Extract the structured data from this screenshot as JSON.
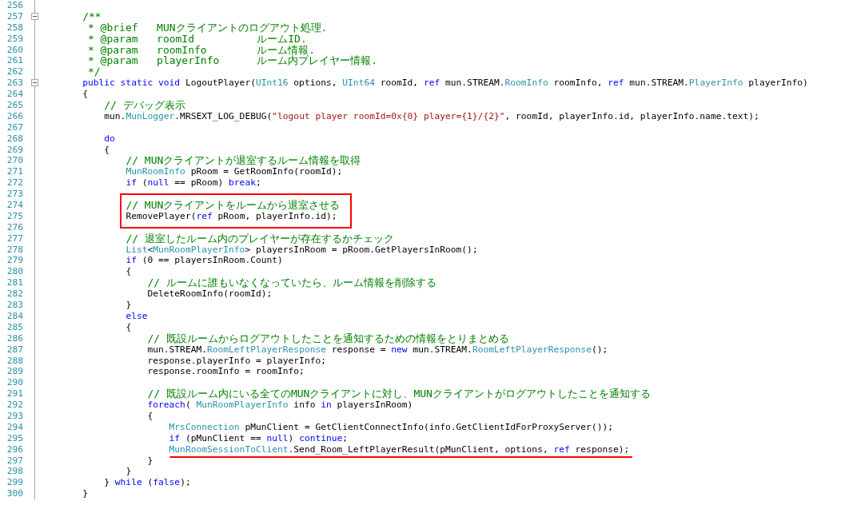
{
  "editor": {
    "lines": [
      {
        "number": "256"
      },
      {
        "number": "257",
        "expanded": true,
        "tokens": [
          {
            "kind": "comment",
            "text": "        /**"
          }
        ]
      },
      {
        "number": "258",
        "tokens": [
          {
            "kind": "comment",
            "text": "         * @brief   MUNクライアントのログアウト処理."
          }
        ]
      },
      {
        "number": "259",
        "tokens": [
          {
            "kind": "comment",
            "text": "         * @param   roomId          ルームID."
          }
        ]
      },
      {
        "number": "260",
        "tokens": [
          {
            "kind": "comment",
            "text": "         * @param   roomInfo        ルーム情報."
          }
        ]
      },
      {
        "number": "261",
        "tokens": [
          {
            "kind": "comment",
            "text": "         * @param   playerInfo      ルーム内プレイヤー情報."
          }
        ]
      },
      {
        "number": "262",
        "tokens": [
          {
            "kind": "comment",
            "text": "         */"
          }
        ]
      },
      {
        "number": "263",
        "expanded": true,
        "tokens": [
          {
            "kind": "keyword",
            "text": "        public static void"
          },
          {
            "kind": "plain",
            "text": " LogoutPlayer("
          },
          {
            "kind": "type",
            "text": "UInt16"
          },
          {
            "kind": "plain",
            "text": " options, "
          },
          {
            "kind": "type",
            "text": "UInt64"
          },
          {
            "kind": "plain",
            "text": " roomId, "
          },
          {
            "kind": "keyword",
            "text": "ref"
          },
          {
            "kind": "plain",
            "text": " mun.STREAM."
          },
          {
            "kind": "type",
            "text": "RoomInfo"
          },
          {
            "kind": "plain",
            "text": " roomInfo, "
          },
          {
            "kind": "keyword",
            "text": "ref"
          },
          {
            "kind": "plain",
            "text": " mun.STREAM."
          },
          {
            "kind": "type",
            "text": "PlayerInfo"
          },
          {
            "kind": "plain",
            "text": " playerInfo)"
          }
        ]
      },
      {
        "number": "264",
        "tokens": [
          {
            "kind": "plain",
            "text": "        {"
          }
        ]
      },
      {
        "number": "265",
        "tokens": [
          {
            "kind": "comment",
            "text": "            // デバッグ表示"
          }
        ]
      },
      {
        "number": "266",
        "tokens": [
          {
            "kind": "plain",
            "text": "            mun."
          },
          {
            "kind": "type",
            "text": "MunLogger"
          },
          {
            "kind": "plain",
            "text": ".MRSEXT_LOG_DEBUG("
          },
          {
            "kind": "string",
            "text": "\"logout player roomId=0x{0} player={1}/{2}\""
          },
          {
            "kind": "plain",
            "text": ", roomId, playerInfo.id, playerInfo.name.text);"
          }
        ]
      },
      {
        "number": "267"
      },
      {
        "number": "268",
        "tokens": [
          {
            "kind": "keyword",
            "text": "            do"
          }
        ]
      },
      {
        "number": "269",
        "tokens": [
          {
            "kind": "plain",
            "text": "            {"
          }
        ]
      },
      {
        "number": "270",
        "tokens": [
          {
            "kind": "comment",
            "text": "                // MUNクライアントが退室するルーム情報を取得"
          }
        ]
      },
      {
        "number": "271",
        "tokens": [
          {
            "kind": "type",
            "text": "                MunRoomInfo"
          },
          {
            "kind": "plain",
            "text": " pRoom = GetRoomInfo(roomId);"
          }
        ]
      },
      {
        "number": "272",
        "tokens": [
          {
            "kind": "keyword",
            "text": "                if"
          },
          {
            "kind": "plain",
            "text": " ("
          },
          {
            "kind": "keyword",
            "text": "null"
          },
          {
            "kind": "plain",
            "text": " == pRoom) "
          },
          {
            "kind": "keyword",
            "text": "break"
          },
          {
            "kind": "plain",
            "text": ";"
          }
        ]
      },
      {
        "number": "273"
      },
      {
        "number": "274",
        "boxed": true,
        "tokens": [
          {
            "kind": "comment",
            "text": "                // MUNクライアントをルームから退室させる"
          }
        ]
      },
      {
        "number": "275",
        "boxed": true,
        "tokens": [
          {
            "kind": "plain",
            "text": "                RemovePlayer("
          },
          {
            "kind": "keyword",
            "text": "ref"
          },
          {
            "kind": "plain",
            "text": " pRoom, playerInfo.id);"
          }
        ]
      },
      {
        "number": "276"
      },
      {
        "number": "277",
        "tokens": [
          {
            "kind": "comment",
            "text": "                // 退室したルーム内のプレイヤーが存在するかチェック"
          }
        ]
      },
      {
        "number": "278",
        "tokens": [
          {
            "kind": "type",
            "text": "                List"
          },
          {
            "kind": "plain",
            "text": "<"
          },
          {
            "kind": "type",
            "text": "MunRoomPlayerInfo"
          },
          {
            "kind": "plain",
            "text": "> playersInRoom = pRoom.GetPlayersInRoom();"
          }
        ]
      },
      {
        "number": "279",
        "tokens": [
          {
            "kind": "keyword",
            "text": "                if"
          },
          {
            "kind": "plain",
            "text": " (0 == playersInRoom.Count)"
          }
        ]
      },
      {
        "number": "280",
        "tokens": [
          {
            "kind": "plain",
            "text": "                {"
          }
        ]
      },
      {
        "number": "281",
        "tokens": [
          {
            "kind": "comment",
            "text": "                    // ルームに誰もいなくなっていたら、ルーム情報を削除する"
          }
        ]
      },
      {
        "number": "282",
        "tokens": [
          {
            "kind": "plain",
            "text": "                    DeleteRoomInfo(roomId);"
          }
        ]
      },
      {
        "number": "283",
        "tokens": [
          {
            "kind": "plain",
            "text": "                }"
          }
        ]
      },
      {
        "number": "284",
        "tokens": [
          {
            "kind": "keyword",
            "text": "                else"
          }
        ]
      },
      {
        "number": "285",
        "tokens": [
          {
            "kind": "plain",
            "text": "                {"
          }
        ]
      },
      {
        "number": "286",
        "tokens": [
          {
            "kind": "comment",
            "text": "                    // 既設ルームからログアウトしたことを通知するための情報をとりまとめる"
          }
        ]
      },
      {
        "number": "287",
        "tokens": [
          {
            "kind": "plain",
            "text": "                    mun.STREAM."
          },
          {
            "kind": "type",
            "text": "RoomLeftPlayerResponse"
          },
          {
            "kind": "plain",
            "text": " response = "
          },
          {
            "kind": "keyword",
            "text": "new"
          },
          {
            "kind": "plain",
            "text": " mun.STREAM."
          },
          {
            "kind": "type",
            "text": "RoomLeftPlayerResponse"
          },
          {
            "kind": "plain",
            "text": "();"
          }
        ]
      },
      {
        "number": "288",
        "tokens": [
          {
            "kind": "plain",
            "text": "                    response.playerInfo = playerInfo;"
          }
        ]
      },
      {
        "number": "289",
        "tokens": [
          {
            "kind": "plain",
            "text": "                    response.roomInfo = roomInfo;"
          }
        ]
      },
      {
        "number": "290"
      },
      {
        "number": "291",
        "tokens": [
          {
            "kind": "comment",
            "text": "                    // 既設ルーム内にいる全てのMUNクライアントに対し、MUNクライアントがログアウトしたことを通知する"
          }
        ]
      },
      {
        "number": "292",
        "tokens": [
          {
            "kind": "keyword",
            "text": "                    foreach"
          },
          {
            "kind": "plain",
            "text": "( "
          },
          {
            "kind": "type",
            "text": "MunRoomPlayerInfo"
          },
          {
            "kind": "plain",
            "text": " info "
          },
          {
            "kind": "keyword",
            "text": "in"
          },
          {
            "kind": "plain",
            "text": " playersInRoom)"
          }
        ]
      },
      {
        "number": "293",
        "tokens": [
          {
            "kind": "plain",
            "text": "                    {"
          }
        ]
      },
      {
        "number": "294",
        "tokens": [
          {
            "kind": "type",
            "text": "                        MrsConnection"
          },
          {
            "kind": "plain",
            "text": " pMunClient = GetClientConnectInfo(info.GetClientIdForProxyServer());"
          }
        ]
      },
      {
        "number": "295",
        "tokens": [
          {
            "kind": "keyword",
            "text": "                        if"
          },
          {
            "kind": "plain",
            "text": " (pMunClient == "
          },
          {
            "kind": "keyword",
            "text": "null"
          },
          {
            "kind": "plain",
            "text": ") "
          },
          {
            "kind": "keyword",
            "text": "continue"
          },
          {
            "kind": "plain",
            "text": ";"
          }
        ]
      },
      {
        "number": "296",
        "underlined": true,
        "tokens": [
          {
            "kind": "type",
            "text": "                        MunRoomSessionToClient"
          },
          {
            "kind": "plain",
            "text": ".Send_Room_LeftPlayerResult(pMunClient, options, "
          },
          {
            "kind": "keyword",
            "text": "ref"
          },
          {
            "kind": "plain",
            "text": " response);"
          }
        ]
      },
      {
        "number": "297",
        "tokens": [
          {
            "kind": "plain",
            "text": "                    }"
          }
        ]
      },
      {
        "number": "298",
        "tokens": [
          {
            "kind": "plain",
            "text": "                }"
          }
        ]
      },
      {
        "number": "299",
        "tokens": [
          {
            "kind": "plain",
            "text": "            } "
          },
          {
            "kind": "keyword",
            "text": "while"
          },
          {
            "kind": "plain",
            "text": " ("
          },
          {
            "kind": "keyword",
            "text": "false"
          },
          {
            "kind": "plain",
            "text": ");"
          }
        ]
      },
      {
        "number": "300",
        "tokens": [
          {
            "kind": "plain",
            "text": "        }"
          }
        ]
      }
    ]
  }
}
